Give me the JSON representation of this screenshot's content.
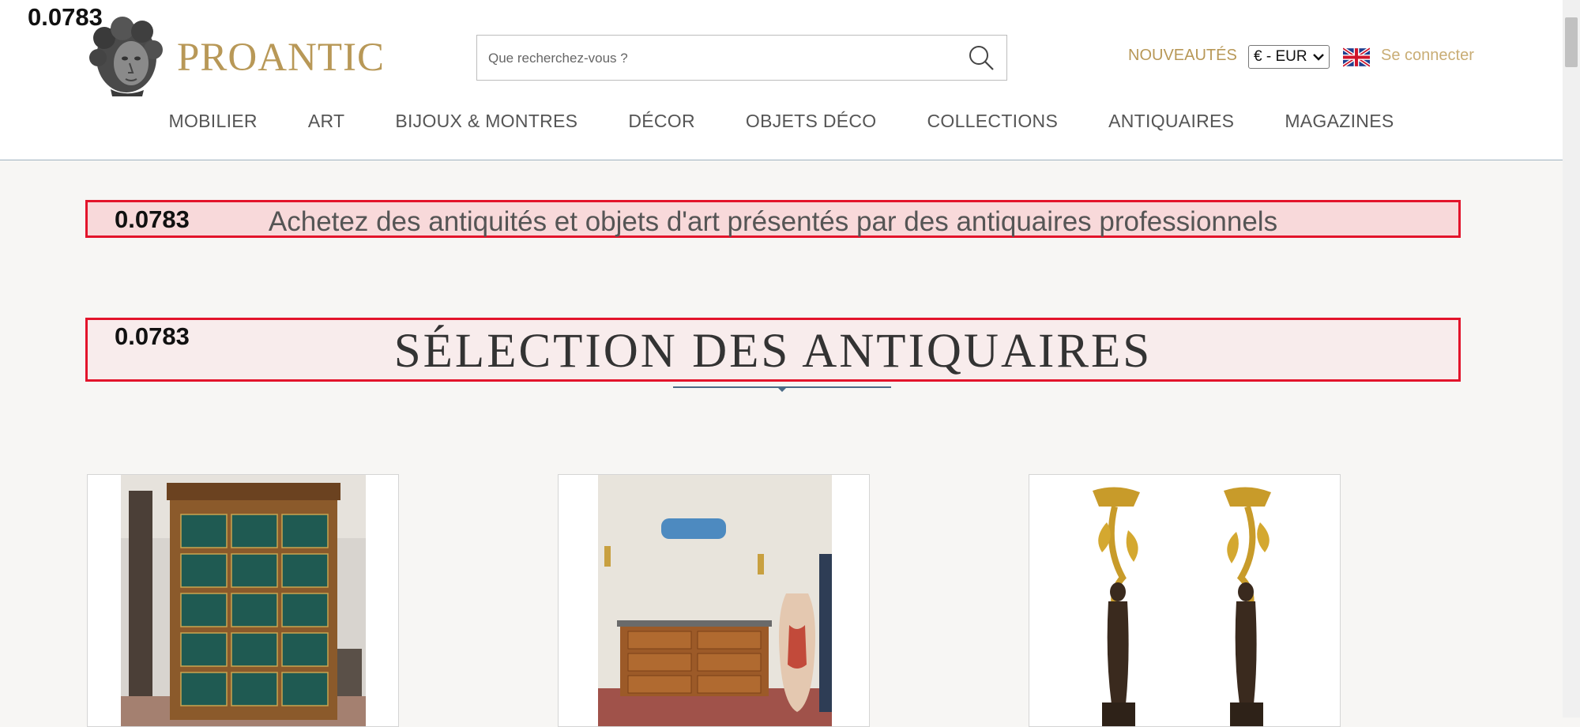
{
  "overlay_scores": [
    "0.0783",
    "0.0783",
    "0.0783"
  ],
  "header": {
    "logo_text": "PROANTIC",
    "search_placeholder": "Que recherchez-vous ?",
    "nouveautes_label": "NOUVEAUTÉS",
    "currency_value": "€ - EUR",
    "login_label": "Se connecter"
  },
  "nav": {
    "items": [
      "MOBILIER",
      "ART",
      "BIJOUX & MONTRES",
      "DÉCOR",
      "OBJETS DÉCO",
      "COLLECTIONS",
      "ANTIQUAIRES",
      "MAGAZINES"
    ]
  },
  "main": {
    "tagline": "Achetez des antiquités et objets d'art présentés par des antiquaires professionnels",
    "section_title": "SÉLECTION DES ANTIQUAIRES",
    "cards": [
      {
        "image": "filing-cabinet-photo"
      },
      {
        "image": "commode-and-vase-photo"
      },
      {
        "image": "bronze-candelabra-photo"
      }
    ]
  },
  "colors": {
    "brand_gold": "#b89857",
    "highlight_border": "#e3142b",
    "page_bg": "#f7f6f4"
  }
}
